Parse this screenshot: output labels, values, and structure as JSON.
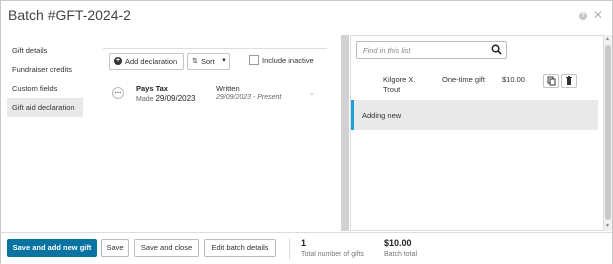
{
  "header": {
    "title": "Batch #GFT-2024-2",
    "help_glyph": "?",
    "close_glyph": "✕"
  },
  "sidebar": {
    "items": [
      {
        "label": "Gift details"
      },
      {
        "label": "Fundraiser credits"
      },
      {
        "label": "Custom fields"
      },
      {
        "label": "Gift aid declaration",
        "active": true
      }
    ]
  },
  "toolbar": {
    "add_label": "Add declaration",
    "sort_label": "Sort",
    "include_inactive_label": "Include inactive"
  },
  "declaration": {
    "title": "Pays Tax",
    "made_prefix": "Made",
    "made_date": "29/09/2023",
    "type": "Written",
    "range": "29/09/2023 - Present"
  },
  "gifts_panel": {
    "search_placeholder": "Find in this list",
    "gift": {
      "donor": "Kilgore X. Trout",
      "type": "One-time gift",
      "amount": "$10.00"
    },
    "adding_label": "Adding new"
  },
  "footer": {
    "save_add_new_label": "Save and add new gift",
    "save_label": "Save",
    "save_close_label": "Save and close",
    "edit_batch_label": "Edit batch details",
    "gift_count": "1",
    "gift_count_label": "Total number of gifts",
    "batch_total": "$10.00",
    "batch_total_label": "Batch total"
  },
  "colors": {
    "primary": "#0974a1",
    "accent": "#1ba1d7",
    "active_nav": "#e9e9e9"
  }
}
